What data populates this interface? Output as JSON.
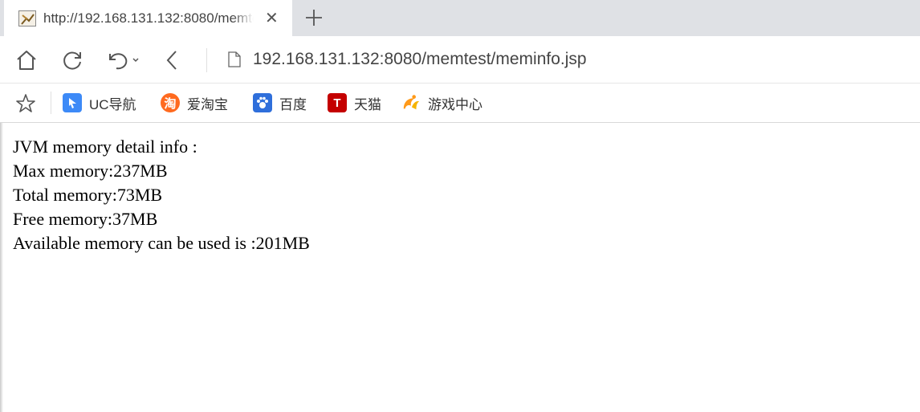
{
  "tab": {
    "title": "http://192.168.131.132:8080/memtest/meminfo.jsp",
    "close_glyph": "✕",
    "new_tab_icon": "plus-icon"
  },
  "nav": {
    "url": "192.168.131.132:8080/memtest/meminfo.jsp",
    "icons": [
      "home-icon",
      "reload-icon",
      "undo-icon",
      "back-icon",
      "page-icon"
    ]
  },
  "bookmarks": [
    {
      "label": "UC导航",
      "icon": "uc-nav-icon",
      "color": "#3d8af7"
    },
    {
      "label": "爱淘宝",
      "icon": "taobao-icon",
      "color": "#ff6a1f"
    },
    {
      "label": "百度",
      "icon": "baidu-icon",
      "color": "#2f6fdb"
    },
    {
      "label": "天猫",
      "icon": "tmall-icon",
      "color": "#c40000"
    },
    {
      "label": "游戏中心",
      "icon": "game-center-icon",
      "color": "#ff9a1a"
    }
  ],
  "content": {
    "lines": [
      "JVM memory detail info :",
      "Max memory:237MB",
      "Total memory:73MB",
      "Free memory:37MB",
      "Available memory can be used is :201MB"
    ]
  }
}
